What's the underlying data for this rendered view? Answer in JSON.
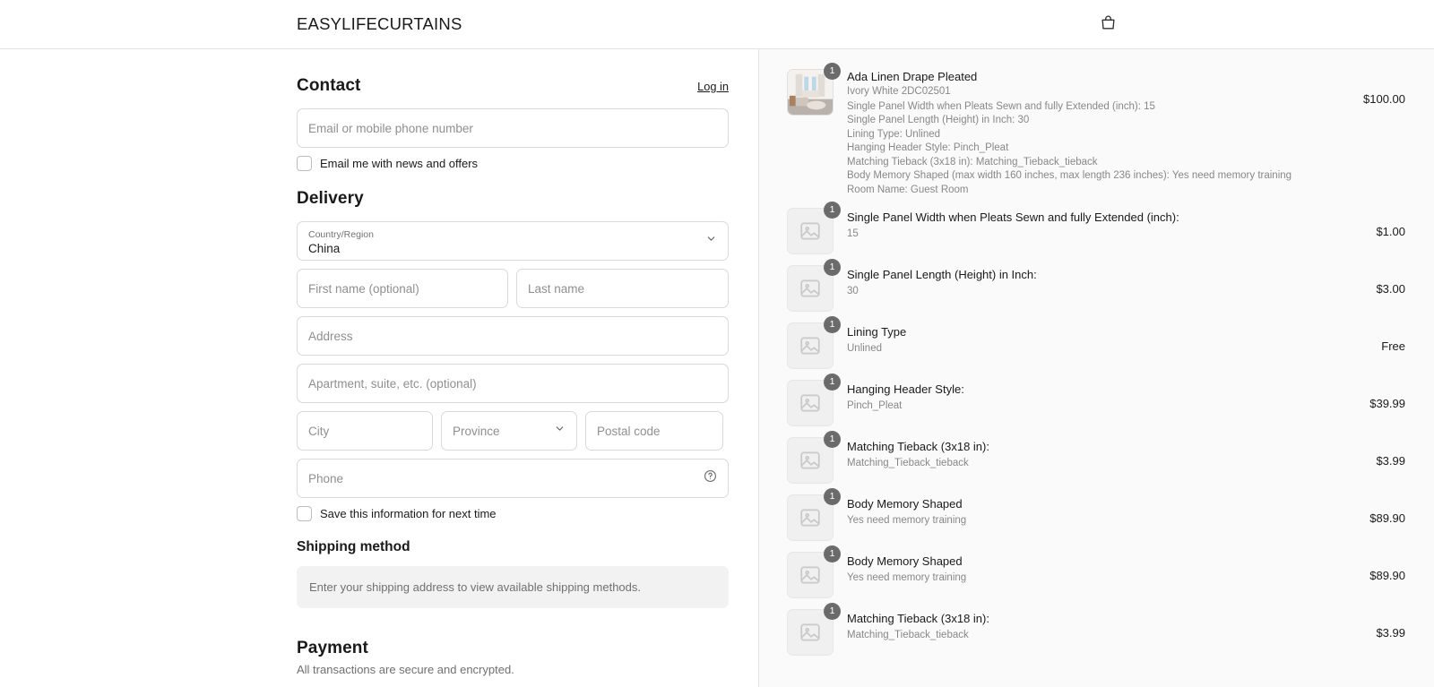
{
  "header": {
    "brand": "EASYLIFECURTAINS",
    "cart_icon": "shopping-bag-icon"
  },
  "contact": {
    "title": "Contact",
    "login_label": "Log in",
    "email_placeholder": "Email or mobile phone number",
    "email_value": "",
    "newsletter_label": "Email me with news and offers",
    "newsletter_checked": false
  },
  "delivery": {
    "title": "Delivery",
    "country_label": "Country/Region",
    "country_value": "China",
    "first_name_placeholder": "First name (optional)",
    "first_name_value": "",
    "last_name_placeholder": "Last name",
    "last_name_value": "",
    "address_placeholder": "Address",
    "address_value": "",
    "apartment_placeholder": "Apartment, suite, etc. (optional)",
    "apartment_value": "",
    "city_placeholder": "City",
    "city_value": "",
    "province_placeholder": "Province",
    "postal_placeholder": "Postal code",
    "postal_value": "",
    "phone_placeholder": "Phone",
    "phone_value": "",
    "save_info_label": "Save this information for next time",
    "save_info_checked": false
  },
  "shipping": {
    "title": "Shipping method",
    "notice": "Enter your shipping address to view available shipping methods."
  },
  "payment": {
    "title": "Payment",
    "note": "All transactions are secure and encrypted."
  },
  "order_summary": {
    "items": [
      {
        "qty": "1",
        "title": "Ada Linen Drape Pleated",
        "variant": "Ivory White 2DC02501",
        "price": "$100.00",
        "thumb": "curtain-room-photo",
        "options": [
          "Single Panel Width when Pleats Sewn and fully Extended (inch): 15",
          "Single Panel Length (Height) in Inch: 30",
          "Lining Type: Unlined",
          "Hanging Header Style: Pinch_Pleat",
          "Matching Tieback  (3x18 in): Matching_Tieback_tieback",
          "Body Memory Shaped (max width 160 inches, max length 236 inches): Yes need memory training",
          "Room Name: Guest Room"
        ]
      },
      {
        "qty": "1",
        "title": "Single Panel Width when Pleats Sewn and fully Extended (inch):",
        "variant": "15",
        "price": "$1.00",
        "thumb": "image-placeholder-icon",
        "options": []
      },
      {
        "qty": "1",
        "title": "Single Panel Length (Height) in Inch:",
        "variant": "30",
        "price": "$3.00",
        "thumb": "image-placeholder-icon",
        "options": []
      },
      {
        "qty": "1",
        "title": "Lining Type",
        "variant": "Unlined",
        "price": "Free",
        "thumb": "image-placeholder-icon",
        "options": []
      },
      {
        "qty": "1",
        "title": "Hanging Header Style:",
        "variant": "Pinch_Pleat",
        "price": "$39.99",
        "thumb": "image-placeholder-icon",
        "options": []
      },
      {
        "qty": "1",
        "title": "Matching Tieback  (3x18 in):",
        "variant": "Matching_Tieback_tieback",
        "price": "$3.99",
        "thumb": "image-placeholder-icon",
        "options": []
      },
      {
        "qty": "1",
        "title": "Body Memory Shaped",
        "variant": "Yes need memory training",
        "price": "$89.90",
        "thumb": "image-placeholder-icon",
        "options": []
      },
      {
        "qty": "1",
        "title": "Body Memory Shaped",
        "variant": "Yes need memory training",
        "price": "$89.90",
        "thumb": "image-placeholder-icon",
        "options": []
      },
      {
        "qty": "1",
        "title": "Matching Tieback  (3x18 in):",
        "variant": "Matching_Tieback_tieback",
        "price": "$3.99",
        "thumb": "image-placeholder-icon",
        "options": []
      }
    ]
  },
  "colors": {
    "page_bg": "#ffffff",
    "summary_bg": "#fafafa",
    "border": "#d9d9d9",
    "text": "#1a1a1a",
    "muted": "#888888",
    "badge": "#6b6b6b",
    "notice_bg": "#f2f2f2"
  }
}
